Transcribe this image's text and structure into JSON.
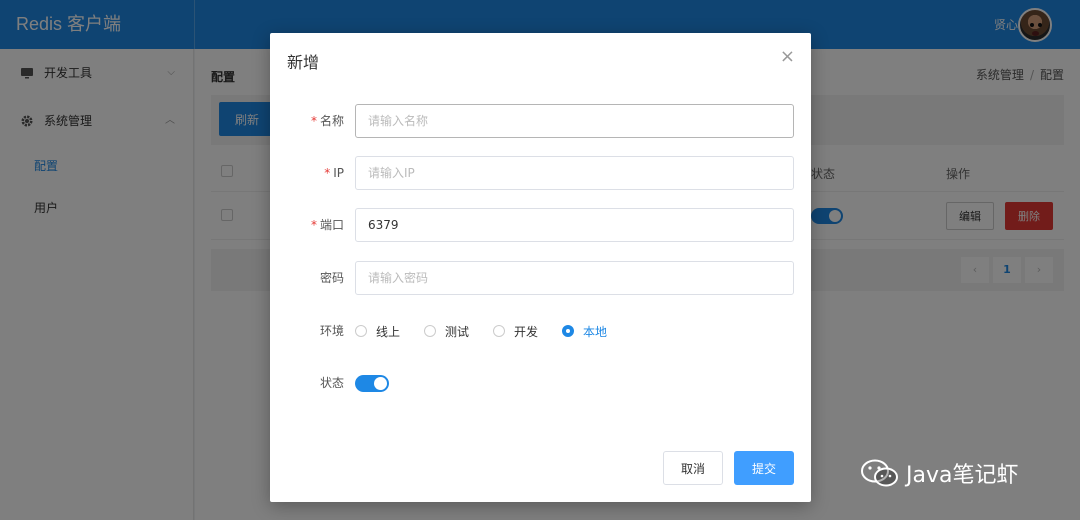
{
  "header": {
    "brand": "Redis 客户端",
    "user_name": "贤心"
  },
  "sidebar": {
    "groups": [
      {
        "label": "开发工具",
        "icon": "monitor-icon",
        "expanded": false
      },
      {
        "label": "系统管理",
        "icon": "gear-icon",
        "expanded": true,
        "items": [
          {
            "label": "配置",
            "active": true
          },
          {
            "label": "用户",
            "active": false
          }
        ]
      }
    ]
  },
  "main": {
    "page_title": "配置",
    "breadcrumb": [
      "系统管理",
      "配置"
    ],
    "toolbar": {
      "refresh_label": "刷新"
    },
    "table": {
      "columns": {
        "status": "状态",
        "ops": "操作"
      },
      "row": {
        "edit_label": "编辑",
        "delete_label": "删除",
        "status_on": true
      }
    },
    "pagination": {
      "current_page": "1"
    }
  },
  "modal": {
    "title": "新增",
    "close_glyph": "×",
    "fields": {
      "name": {
        "label": "名称",
        "required": true,
        "value": "",
        "placeholder": "请输入名称"
      },
      "ip": {
        "label": "IP",
        "required": true,
        "value": "",
        "placeholder": "请输入IP"
      },
      "port": {
        "label": "端口",
        "required": true,
        "value": "6379",
        "placeholder": ""
      },
      "password": {
        "label": "密码",
        "required": false,
        "value": "",
        "placeholder": "请输入密码"
      },
      "env": {
        "label": "环境",
        "options": [
          "线上",
          "测试",
          "开发",
          "本地"
        ],
        "selected": "本地"
      },
      "status": {
        "label": "状态",
        "on": true
      }
    },
    "cancel_label": "取消",
    "submit_label": "提交"
  },
  "watermark": {
    "text": "Java笔记虾"
  },
  "colors": {
    "primary": "#1e88e5",
    "button_blue": "#409eff",
    "danger": "#e53935",
    "required": "#e53935"
  }
}
